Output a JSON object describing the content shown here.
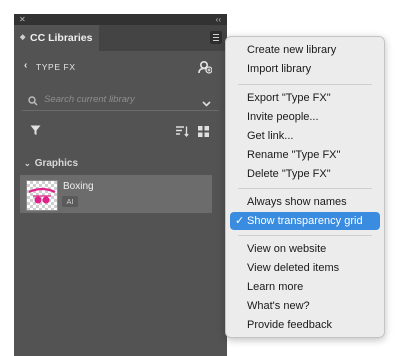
{
  "panel": {
    "tab_title": "CC Libraries",
    "library_name": "TYPE FX",
    "search_placeholder": "Search current library",
    "section_title": "Graphics",
    "asset": {
      "name": "Boxing",
      "type_badge": "AI"
    }
  },
  "icons": {
    "close": "close-icon",
    "collapse": "double-chevron-icon",
    "panel_menu": "hamburger-menu-icon",
    "back": "chevron-left-icon",
    "add_user": "add-user-icon",
    "search": "search-icon",
    "dropdown": "chevron-down-icon",
    "filter": "filter-icon",
    "sort": "sort-icon",
    "grid_view": "grid-view-icon",
    "section_toggle": "disclosure-triangle-icon"
  },
  "menu": {
    "items": [
      "Create new library",
      "Import library",
      "Export \"Type FX\"",
      "Invite people...",
      "Get link...",
      "Rename \"Type FX\"",
      "Delete \"Type FX\"",
      "Always show names",
      "Show transparency grid",
      "View on website",
      "View deleted items",
      "Learn more",
      "What's new?",
      "Provide feedback"
    ],
    "checked_item": "Show transparency grid",
    "check_mark": "✓"
  },
  "colors": {
    "panel_bg": "#535353",
    "menu_bg": "#ececec",
    "selection": "#3a8ce0",
    "thumbnail_accent": "#e0218a"
  }
}
